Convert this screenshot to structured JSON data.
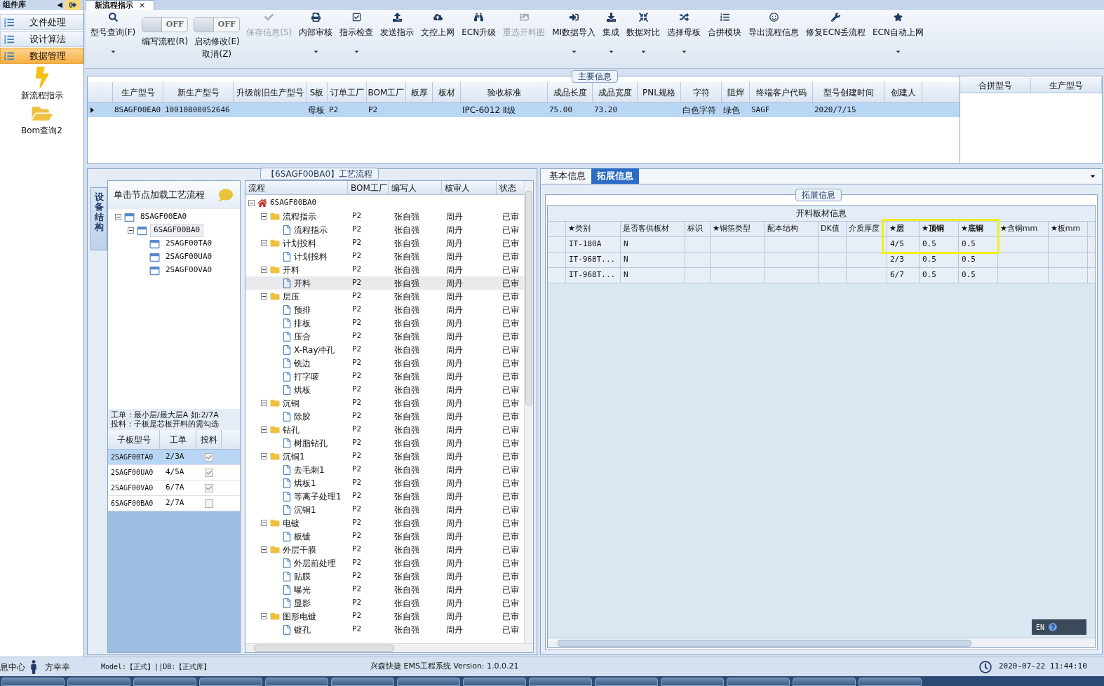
{
  "panel_header": {
    "title": "组件库",
    "collapse_glyph": "◀"
  },
  "document_tab": {
    "title": "新流程指示",
    "close": "×"
  },
  "sidebar": {
    "items": [
      {
        "label": "文件处理",
        "selected": false
      },
      {
        "label": "设计算法",
        "selected": false
      },
      {
        "label": "数据管理",
        "selected": true
      }
    ],
    "tools": [
      {
        "label": "新流程指示",
        "kind": "bolt"
      },
      {
        "label": "Bom查询2",
        "kind": "folder"
      }
    ]
  },
  "toolbar": [
    {
      "kind": "button",
      "label": "型号查询(F)",
      "dropdown": true,
      "disabled": false
    },
    {
      "kind": "toggle",
      "switch": "OFF",
      "on": false,
      "label": "编写流程(R)"
    },
    {
      "kind": "toggle",
      "switch": "OFF",
      "on": false,
      "label": "启动修改(E)",
      "label_2": "取消(Z)"
    },
    {
      "kind": "button",
      "label": "保存信息(S)",
      "dropdown": false,
      "disabled": true
    },
    {
      "kind": "button",
      "label": "内部审核",
      "dropdown": true,
      "disabled": false
    },
    {
      "kind": "button",
      "label": "指示检查",
      "dropdown": true,
      "disabled": false
    },
    {
      "kind": "button",
      "label": "发送指示",
      "dropdown": false,
      "disabled": false
    },
    {
      "kind": "button",
      "label": "文控上网",
      "dropdown": false,
      "disabled": false
    },
    {
      "kind": "button",
      "label": "ECN升级",
      "dropdown": false,
      "disabled": false
    },
    {
      "kind": "button",
      "label": "重选开料图",
      "dropdown": false,
      "disabled": true
    },
    {
      "kind": "button",
      "label": "MI数据导入",
      "dropdown": true,
      "disabled": false
    },
    {
      "kind": "button",
      "label": "集成",
      "dropdown": true,
      "disabled": false
    },
    {
      "kind": "button",
      "label": "数据对比",
      "dropdown": true,
      "disabled": false
    },
    {
      "kind": "button",
      "label": "选择母板",
      "dropdown": true,
      "disabled": false
    },
    {
      "kind": "button",
      "label": "合拼模块",
      "dropdown": false,
      "disabled": false
    },
    {
      "kind": "button",
      "label": "导出流程信息",
      "dropdown": false,
      "disabled": false
    },
    {
      "kind": "button",
      "label": "修复ECN丢流程",
      "dropdown": false,
      "disabled": false
    },
    {
      "kind": "button",
      "label": "ECN自动上网",
      "dropdown": true,
      "disabled": false
    }
  ],
  "main_info": {
    "title": "主要信息",
    "columns": [
      "生产型号",
      "新生产型号",
      "升级前旧生产型号",
      "S板",
      "订单工厂",
      "BOM工厂",
      "板厚",
      "板材",
      "验收标准",
      "成品长度",
      "成品宽度",
      "PNL规格",
      "字符",
      "阻焊",
      "终端客户代码",
      "型号创建时间",
      "创建人"
    ],
    "rows": [
      {
        "selected": true,
        "cells": [
          "8SAGF00EA0",
          "10010800052646",
          null,
          "母板",
          "P2",
          "P2",
          null,
          null,
          "IPC-6012 Ⅱ级",
          "75.00",
          "73.20",
          null,
          "白色字符",
          "绿色",
          "SAGF",
          "2020/7/15",
          null
        ]
      }
    ],
    "merge_columns": [
      "合拼型号",
      "生产型号"
    ]
  },
  "process": {
    "title": "【6SAGF00BA0】工艺流程",
    "side_tab": "设备结构",
    "hint": "单击节点加载工艺流程",
    "structure": [
      {
        "name": "8SAGF00EA0",
        "selected": false,
        "children": [
          {
            "name": "6SAGF00BA0",
            "selected": true,
            "children": [
              {
                "name": "2SAGF00TA0",
                "selected": false
              },
              {
                "name": "2SAGF00UA0",
                "selected": false
              },
              {
                "name": "2SAGF00VA0",
                "selected": false
              }
            ]
          }
        ]
      }
    ],
    "note": [
      "工单：最小层/最大层A 如:2/7A",
      "投料：子板是芯板开料的需勾选"
    ],
    "sub_boards": {
      "columns": [
        "子板型号",
        "工单",
        "投料"
      ],
      "rows": [
        {
          "model": "2SAGF00TA0",
          "order": "2/3A",
          "checked": true,
          "selected": true
        },
        {
          "model": "2SAGF00UA0",
          "order": "4/5A",
          "checked": true,
          "selected": false
        },
        {
          "model": "2SAGF00VA0",
          "order": "6/7A",
          "checked": true,
          "selected": false
        },
        {
          "model": "6SAGF00BA0",
          "order": "2/7A",
          "checked": false,
          "selected": false
        }
      ]
    },
    "flow_columns": [
      "流程",
      "BOM工厂",
      "编写人",
      "核审人",
      "状态"
    ],
    "flow": [
      {
        "kind": "root",
        "name": "6SAGF00BA0",
        "selected": false,
        "children": [
          {
            "kind": "group",
            "name": "流程指示",
            "bom": "P2",
            "writer": "张自强",
            "reviewer": "周丹",
            "status": "已审",
            "selected": false,
            "children": [
              {
                "kind": "step",
                "name": "流程指示",
                "bom": "P2",
                "writer": "张自强",
                "reviewer": "周丹",
                "status": "已审",
                "selected": false
              }
            ]
          },
          {
            "kind": "group",
            "name": "计划投料",
            "bom": "P2",
            "writer": "张自强",
            "reviewer": "周丹",
            "status": "已审",
            "selected": false,
            "children": [
              {
                "kind": "step",
                "name": "计划投料",
                "bom": "P2",
                "writer": "张自强",
                "reviewer": "周丹",
                "status": "已审",
                "selected": false
              }
            ]
          },
          {
            "kind": "group",
            "name": "开料",
            "bom": "P2",
            "writer": "张自强",
            "reviewer": "周丹",
            "status": "已审",
            "selected": false,
            "children": [
              {
                "kind": "step",
                "name": "开料",
                "bom": "P2",
                "writer": "张自强",
                "reviewer": "周丹",
                "status": "已审",
                "selected": true
              }
            ]
          },
          {
            "kind": "group",
            "name": "层压",
            "bom": "P2",
            "writer": "张自强",
            "reviewer": "周丹",
            "status": "已审",
            "selected": false,
            "children": [
              {
                "kind": "step",
                "name": "预排",
                "bom": "P2",
                "writer": "张自强",
                "reviewer": "周丹",
                "status": "已审",
                "selected": false
              },
              {
                "kind": "step",
                "name": "排板",
                "bom": "P2",
                "writer": "张自强",
                "reviewer": "周丹",
                "status": "已审",
                "selected": false
              },
              {
                "kind": "step",
                "name": "压合",
                "bom": "P2",
                "writer": "张自强",
                "reviewer": "周丹",
                "status": "已审",
                "selected": false
              },
              {
                "kind": "step",
                "name": "X-Ray冲孔",
                "bom": "P2",
                "writer": "张自强",
                "reviewer": "周丹",
                "status": "已审",
                "selected": false
              },
              {
                "kind": "step",
                "name": "铣边",
                "bom": "P2",
                "writer": "张自强",
                "reviewer": "周丹",
                "status": "已审",
                "selected": false
              },
              {
                "kind": "step",
                "name": "打字唛",
                "bom": "P2",
                "writer": "张自强",
                "reviewer": "周丹",
                "status": "已审",
                "selected": false
              },
              {
                "kind": "step",
                "name": "烘板",
                "bom": "P2",
                "writer": "张自强",
                "reviewer": "周丹",
                "status": "已审",
                "selected": false
              }
            ]
          },
          {
            "kind": "group",
            "name": "沉铜",
            "bom": "P2",
            "writer": "张自强",
            "reviewer": "周丹",
            "status": "已审",
            "selected": false,
            "children": [
              {
                "kind": "step",
                "name": "除胶",
                "bom": "P2",
                "writer": "张自强",
                "reviewer": "周丹",
                "status": "已审",
                "selected": false
              }
            ]
          },
          {
            "kind": "group",
            "name": "钻孔",
            "bom": "P2",
            "writer": "张自强",
            "reviewer": "周丹",
            "status": "已审",
            "selected": false,
            "children": [
              {
                "kind": "step",
                "name": "树脂钻孔",
                "bom": "P2",
                "writer": "张自强",
                "reviewer": "周丹",
                "status": "已审",
                "selected": false
              }
            ]
          },
          {
            "kind": "group",
            "name": "沉铜1",
            "bom": "P2",
            "writer": "张自强",
            "reviewer": "周丹",
            "status": "已审",
            "selected": false,
            "children": [
              {
                "kind": "step",
                "name": "去毛刺1",
                "bom": "P2",
                "writer": "张自强",
                "reviewer": "周丹",
                "status": "已审",
                "selected": false
              },
              {
                "kind": "step",
                "name": "烘板1",
                "bom": "P2",
                "writer": "张自强",
                "reviewer": "周丹",
                "status": "已审",
                "selected": false
              },
              {
                "kind": "step",
                "name": "等离子处理1",
                "bom": "P2",
                "writer": "张自强",
                "reviewer": "周丹",
                "status": "已审",
                "selected": false
              },
              {
                "kind": "step",
                "name": "沉铜1",
                "bom": "P2",
                "writer": "张自强",
                "reviewer": "周丹",
                "status": "已审",
                "selected": false
              }
            ]
          },
          {
            "kind": "group",
            "name": "电镀",
            "bom": "P2",
            "writer": "张自强",
            "reviewer": "周丹",
            "status": "已审",
            "selected": false,
            "children": [
              {
                "kind": "step",
                "name": "板镀",
                "bom": "P2",
                "writer": "张自强",
                "reviewer": "周丹",
                "status": "已审",
                "selected": false
              }
            ]
          },
          {
            "kind": "group",
            "name": "外层干膜",
            "bom": "P2",
            "writer": "张自强",
            "reviewer": "周丹",
            "status": "已审",
            "selected": false,
            "children": [
              {
                "kind": "step",
                "name": "外层前处理",
                "bom": "P2",
                "writer": "张自强",
                "reviewer": "周丹",
                "status": "已审",
                "selected": false
              },
              {
                "kind": "step",
                "name": "贴膜",
                "bom": "P2",
                "writer": "张自强",
                "reviewer": "周丹",
                "status": "已审",
                "selected": false
              },
              {
                "kind": "step",
                "name": "曝光",
                "bom": "P2",
                "writer": "张自强",
                "reviewer": "周丹",
                "status": "已审",
                "selected": false
              },
              {
                "kind": "step",
                "name": "显影",
                "bom": "P2",
                "writer": "张自强",
                "reviewer": "周丹",
                "status": "已审",
                "selected": false
              }
            ]
          },
          {
            "kind": "group",
            "name": "图形电镀",
            "bom": "P2",
            "writer": "张自强",
            "reviewer": "周丹",
            "status": "已审",
            "selected": false,
            "children": [
              {
                "kind": "step",
                "name": "镀孔",
                "bom": "P2",
                "writer": "张自强",
                "reviewer": "周丹",
                "status": "已审",
                "selected": false
              }
            ]
          }
        ]
      }
    ]
  },
  "details": {
    "tabs": [
      {
        "label": "基本信息",
        "selected": false
      },
      {
        "label": "拓展信息",
        "selected": true
      }
    ],
    "group_title": "拓展信息",
    "table_title": "开料板材信息",
    "columns": [
      {
        "label": "★类别",
        "highlighted": false
      },
      {
        "label": "是否客供板材",
        "highlighted": false
      },
      {
        "label": "标识",
        "highlighted": false
      },
      {
        "label": "★铜箔类型",
        "highlighted": false
      },
      {
        "label": "配本结构",
        "highlighted": false
      },
      {
        "label": "DK值",
        "highlighted": false
      },
      {
        "label": "介质厚度",
        "highlighted": false
      },
      {
        "label": "★层",
        "highlighted": true
      },
      {
        "label": "★顶铜",
        "highlighted": true
      },
      {
        "label": "★底铜",
        "highlighted": true
      },
      {
        "label": "★含铜mm",
        "highlighted": false
      },
      {
        "label": "★板mm",
        "highlighted": false
      }
    ],
    "rows": [
      {
        "highlighted": true,
        "cells": [
          "IT-180A",
          "N",
          null,
          null,
          null,
          null,
          null,
          "4/5",
          "0.5",
          "0.5",
          null,
          null
        ]
      },
      {
        "highlighted": false,
        "cells": [
          "IT-968T...",
          "N",
          null,
          null,
          null,
          null,
          null,
          "2/3",
          "0.5",
          "0.5",
          null,
          null
        ]
      },
      {
        "highlighted": false,
        "cells": [
          "IT-968T...",
          "N",
          null,
          null,
          null,
          null,
          null,
          "6/7",
          "0.5",
          "0.5",
          null,
          null
        ]
      }
    ],
    "language": "EN"
  },
  "status_bar": {
    "message_center": "息中心",
    "user": "方幸幸",
    "model": "Model:【正式】||DB:【正式库】",
    "product": "兴森快捷 EMS工程系统 Version: 1.0.0.21",
    "datetime": "2020-07-22 11:44:10"
  }
}
